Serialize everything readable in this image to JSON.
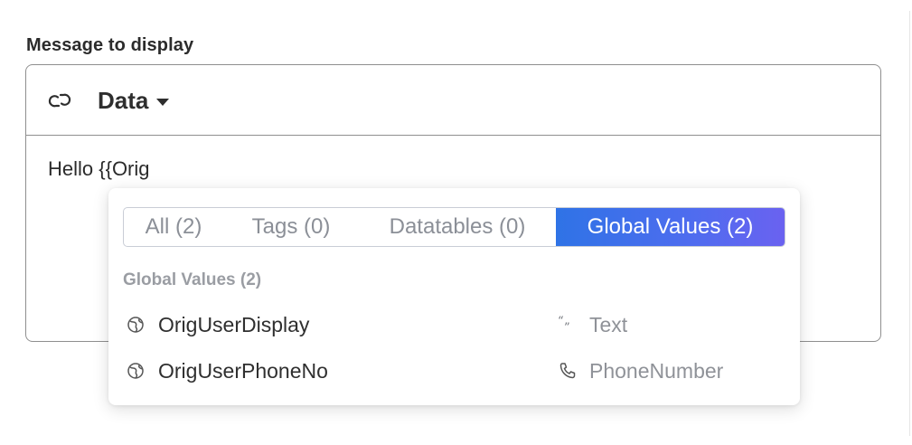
{
  "field": {
    "label": "Message to display"
  },
  "editor": {
    "toolbar": {
      "link_icon": "link-icon",
      "data_menu_label": "Data",
      "data_menu_icon": "caret-down-icon"
    },
    "content": "Hello {{Orig"
  },
  "autocomplete": {
    "tabs": [
      {
        "label": "All (2)",
        "active": false
      },
      {
        "label": "Tags (0)",
        "active": false
      },
      {
        "label": "Datatables (0)",
        "active": false
      },
      {
        "label": "Global Values (2)",
        "active": true
      }
    ],
    "section_title": "Global Values (2)",
    "items": [
      {
        "icon": "globe-icon",
        "name": "OrigUserDisplay",
        "type_icon": "quote-icon",
        "type": "Text"
      },
      {
        "icon": "globe-icon",
        "name": "OrigUserPhoneNo",
        "type_icon": "phone-icon",
        "type": "PhoneNumber"
      }
    ],
    "colors": {
      "active_tab_start": "#2f73e6",
      "active_tab_end": "#6a62f0",
      "inactive_tab_text": "#8b8f97"
    }
  }
}
